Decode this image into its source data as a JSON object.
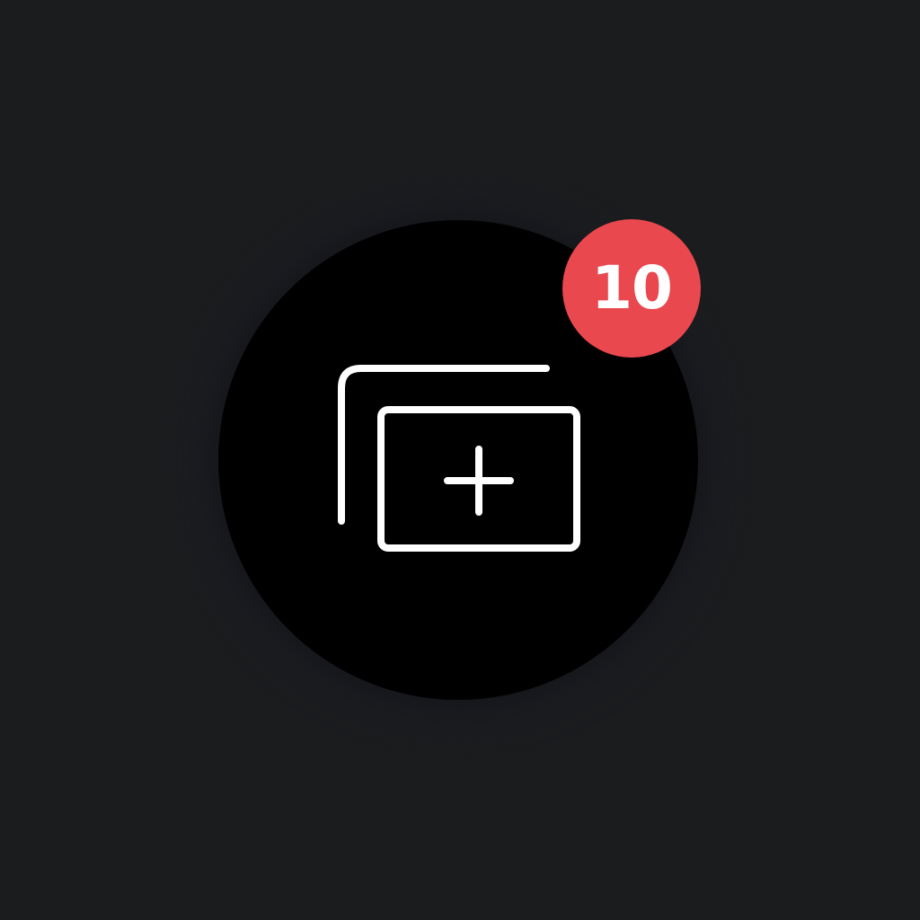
{
  "fab": {
    "icon": "new-tab-stack-icon",
    "badge_count": "10"
  },
  "colors": {
    "background": "#1b1c1e",
    "button": "#000000",
    "icon_stroke": "#ffffff",
    "badge": "#e9484e"
  }
}
